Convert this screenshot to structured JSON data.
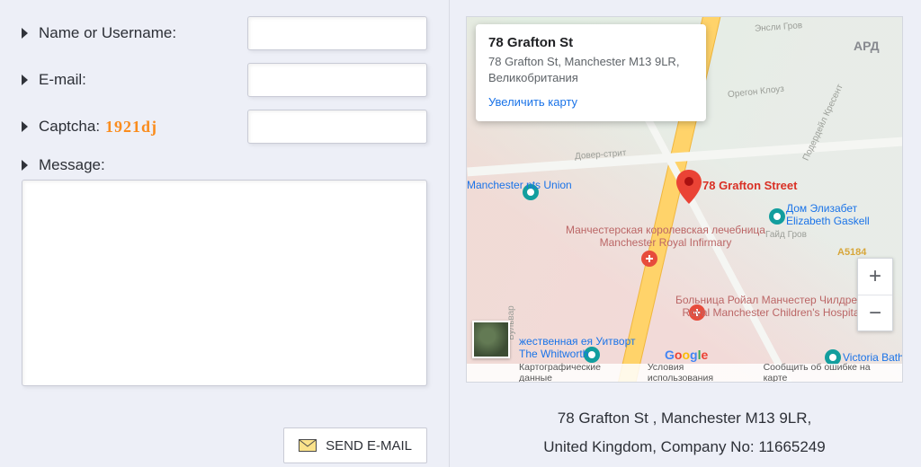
{
  "form": {
    "name_label": "Name or Username:",
    "email_label": "E-mail:",
    "captcha_label": "Captcha:",
    "captcha_value": "1921dj",
    "message_label": "Message:",
    "send_label": "SEND E-MAIL"
  },
  "map": {
    "info_title": "78 Grafton St",
    "info_address": "78 Grafton St, Manchester M13 9LR, Великобритания",
    "enlarge_label": "Увеличить карту",
    "pin_label": "78 Grafton Street",
    "pois": {
      "students_union": "Manchester nts Union",
      "mri_ru": "Манчестерская королевская лечебница",
      "mri_en": "Manchester Royal Infirmary",
      "rmch_ru": "Больница Ройал Манчестер Чилдренс",
      "rmch_en": "Royal Manchester Children's Hospital",
      "gaskell_ru": "Дом Элизабет",
      "gaskell_en": "Elizabeth Gaskell",
      "whitworth_ru": "жественная ея Уитворт",
      "whitworth_en": "The Whitworth",
      "victoria": "Victoria Baths",
      "ard": "АРД",
      "dover": "Довер-стрит",
      "oregon": "Орегон Клоуз",
      "hyde": "Гайд Гров",
      "a5184": "A5184",
      "bulvar": "Бульвар",
      "ensli": "Энсли Гров",
      "poderdale": "Подердейл Кресент"
    },
    "attrib": {
      "carto": "Картографические данные",
      "terms": "Условия использования",
      "report": "Сообщить об ошибке на карте"
    }
  },
  "address": {
    "line1": "78 Grafton St , Manchester M13 9LR,",
    "line2": "United Kingdom, Company No: 11665249"
  }
}
